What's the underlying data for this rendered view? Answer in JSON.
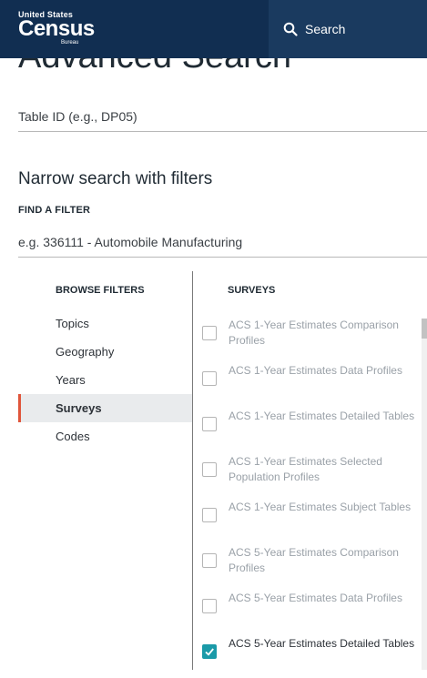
{
  "header": {
    "logo_small": "United States",
    "logo_main": "Census",
    "logo_bureau": "Bureau",
    "search_label": "Search"
  },
  "page_title": "Advanced Search",
  "table_id_placeholder": "Table ID (e.g., DP05)",
  "narrow_heading": "Narrow search with filters",
  "find_filter_label": "FIND A FILTER",
  "filter_placeholder": "e.g. 336111 - Automobile Manufacturing",
  "browse": {
    "heading": "BROWSE FILTERS",
    "items": [
      {
        "label": "Topics"
      },
      {
        "label": "Geography"
      },
      {
        "label": "Years"
      },
      {
        "label": "Surveys"
      },
      {
        "label": "Codes"
      }
    ]
  },
  "surveys": {
    "heading": "SURVEYS",
    "items": [
      {
        "label": "ACS 1-Year Estimates Comparison Profiles",
        "checked": false
      },
      {
        "label": "ACS 1-Year Estimates Data Profiles",
        "checked": false
      },
      {
        "label": "ACS 1-Year Estimates Detailed Tables",
        "checked": false
      },
      {
        "label": "ACS 1-Year Estimates Selected Population Profiles",
        "checked": false
      },
      {
        "label": "ACS 1-Year Estimates Subject Tables",
        "checked": false
      },
      {
        "label": "ACS 5-Year Estimates Comparison Profiles",
        "checked": false
      },
      {
        "label": "ACS 5-Year Estimates Data Profiles",
        "checked": false
      },
      {
        "label": "ACS 5-Year Estimates Detailed Tables",
        "checked": true
      }
    ]
  },
  "colors": {
    "header_bg": "#112e51",
    "active_accent": "#e0563b",
    "checkbox_checked": "#1a9aa8"
  }
}
